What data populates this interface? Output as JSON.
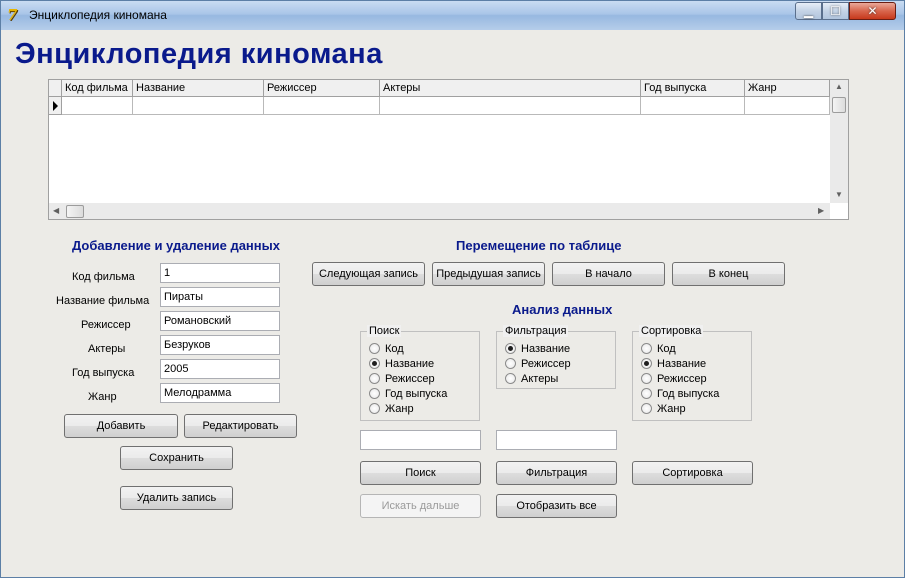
{
  "window": {
    "title": "Энциклопедия киномана",
    "icon": "delphi-app-icon",
    "controls": {
      "minimize": "minimize-icon",
      "maximize": "maximize-icon",
      "close": "close-icon"
    }
  },
  "header": {
    "title": "Энциклопедия киномана"
  },
  "grid": {
    "columns": [
      "Код фильма",
      "Название",
      "Режиссер",
      "Актеры",
      "Год выпуска",
      "Жанр"
    ]
  },
  "add_delete": {
    "title": "Добавление  и удаление данных",
    "fields": [
      {
        "label": "Код фильма",
        "value": "1"
      },
      {
        "label": "Название фильма",
        "value": "Пираты"
      },
      {
        "label": "Режиссер",
        "value": "Романовский"
      },
      {
        "label": "Актеры",
        "value": "Безруков"
      },
      {
        "label": "Год выпуска",
        "value": "2005"
      },
      {
        "label": "Жанр",
        "value": "Мелодрамма"
      }
    ],
    "buttons": {
      "add": "Добавить",
      "edit": "Редактировать",
      "save": "Сохранить",
      "delete": "Удалить запись"
    }
  },
  "navigation": {
    "title": "Перемещение по таблице",
    "buttons": {
      "next": "Следующая запись",
      "prev": "Предыдушая запись",
      "first": "В начало",
      "last": "В конец"
    }
  },
  "analysis": {
    "title": "Анализ данных",
    "search": {
      "group_title": "Поиск",
      "options": [
        "Код",
        "Название",
        "Режиссер",
        "Год выпуска",
        "Жанр"
      ],
      "selected": "Название",
      "input_value": "",
      "button": "Поиск",
      "next_button": "Искать дальше"
    },
    "filter": {
      "group_title": "Фильтрация",
      "options": [
        "Название",
        "Режиссер",
        "Актеры"
      ],
      "selected": "Название",
      "input_value": "",
      "button": "Фильтрация",
      "show_all_button": "Отобразить все"
    },
    "sort": {
      "group_title": "Сортировка",
      "options": [
        "Код",
        "Название",
        "Режиссер",
        "Год выпуска",
        "Жанр"
      ],
      "selected": "Название",
      "button": "Сортировка"
    }
  }
}
